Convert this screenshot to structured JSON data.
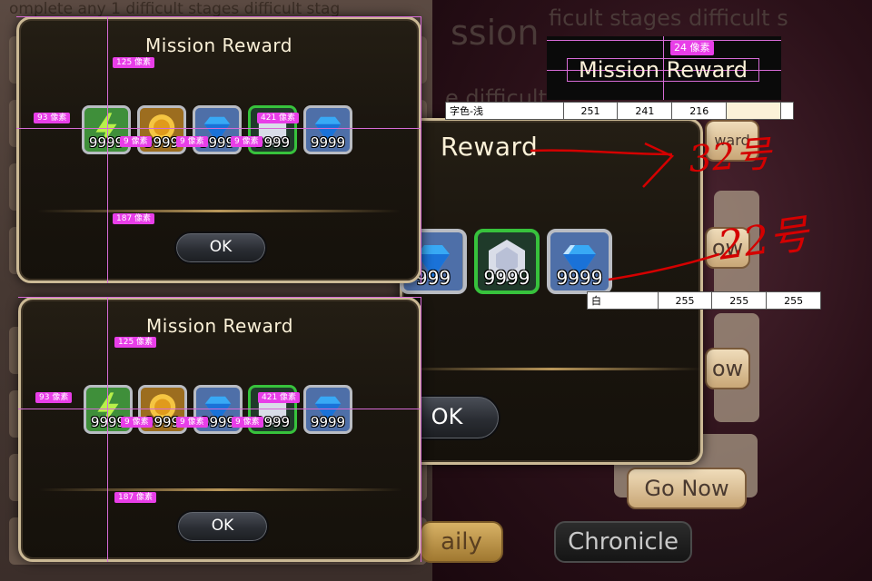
{
  "background": {
    "left_lines": [
      "omplete any 1 difficult stages  difficult stag"
    ],
    "right_ghost_title_fragment": "ssion",
    "right_ghost_subtitle_fragment": "ficult stages  difficult s",
    "right_ghost_row_fragment": "e difficult",
    "right_ghost_reward_fragment": "ward",
    "right_ghost_go_label": "Go Now",
    "right_ghost_partial_now_1": "ow",
    "right_ghost_partial_now_2": "ow",
    "bottom_left_label": "aily",
    "bottom_right_label": "Chronicle"
  },
  "dialog_top": {
    "title": "Mission Reward",
    "ok_label": "OK",
    "items": [
      {
        "icon": "energy-lightning-icon",
        "qty": "9999",
        "frame": "silver"
      },
      {
        "icon": "gold-coin-icon",
        "qty": "9999",
        "frame": "silver"
      },
      {
        "icon": "blue-gem-icon",
        "qty": "9999",
        "frame": "silver"
      },
      {
        "icon": "white-gem-icon",
        "qty": "9999",
        "frame": "green"
      },
      {
        "icon": "blue-gem-icon",
        "qty": "9999",
        "frame": "silver"
      }
    ],
    "measures": {
      "title_to_items": "125 像素",
      "left_margin": "93 像素",
      "gap_1": "9 像素",
      "gap_2": "9 像素",
      "gap_3": "9 像素",
      "item_block": "421 像素",
      "items_to_ok": "187 像素"
    }
  },
  "dialog_bottom": {
    "title": "Mission Reward",
    "ok_label": "OK",
    "items": [
      {
        "icon": "energy-lightning-icon",
        "qty": "9999",
        "frame": "silver"
      },
      {
        "icon": "gold-coin-icon",
        "qty": "9999",
        "frame": "silver"
      },
      {
        "icon": "blue-gem-icon",
        "qty": "9999",
        "frame": "silver"
      },
      {
        "icon": "white-gem-icon",
        "qty": "9999",
        "frame": "green"
      },
      {
        "icon": "blue-gem-icon",
        "qty": "9999",
        "frame": "silver"
      }
    ],
    "measures": {
      "title_to_items": "125 像素",
      "left_margin": "93 像素",
      "gap_1": "9 像素",
      "gap_2": "9 像素",
      "gap_3": "9 像素",
      "item_block": "421 像素",
      "items_to_ok": "187 像素"
    }
  },
  "zoom_dialog": {
    "title": "Reward",
    "ok_label": "OK",
    "items": [
      {
        "icon": "blue-gem-icon",
        "qty": "999",
        "frame": "silver"
      },
      {
        "icon": "white-gem-icon",
        "qty": "9999",
        "frame": "green"
      },
      {
        "icon": "blue-gem-icon",
        "qty": "9999",
        "frame": "silver"
      }
    ]
  },
  "title_zoom": {
    "text": "Mission Reward",
    "height_tag": "24 像素"
  },
  "spec_text_color": {
    "label": "字色-浅",
    "r": "251",
    "g": "241",
    "b": "216",
    "swatch": "#fbf1d8"
  },
  "spec_white": {
    "label": "白",
    "r": "255",
    "g": "255",
    "b": "255"
  },
  "annotations": {
    "title_size_note": "32号",
    "qty_size_note": "22号",
    "color": "#d40000"
  },
  "colors": {
    "guide": "#d66bd6",
    "tag": "#e83ee8",
    "dialog_border": "#cbb995",
    "title_text": "#fbf1d8",
    "green_frame": "#37c23c"
  }
}
